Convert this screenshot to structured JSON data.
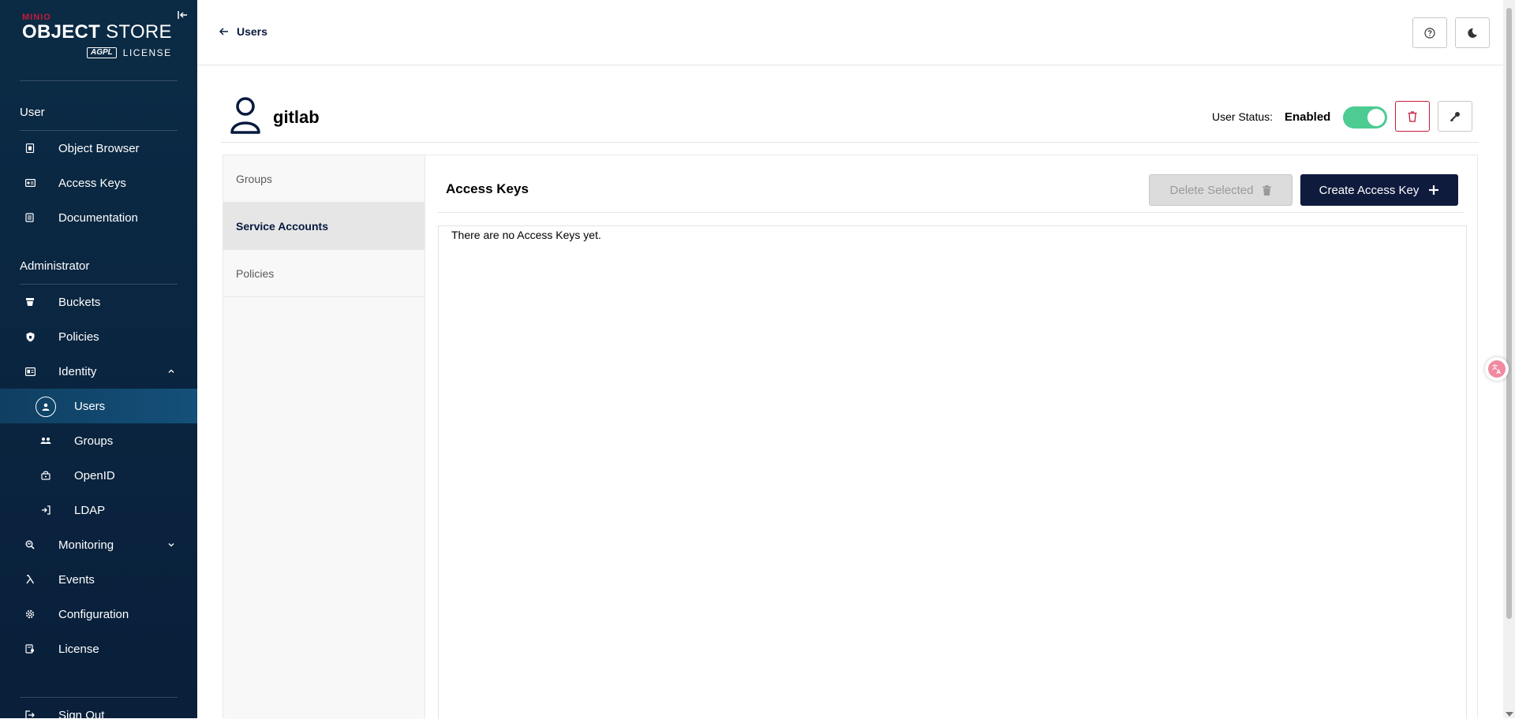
{
  "sidebar": {
    "brand": {
      "top": "MINIO",
      "product_bold": "OBJECT",
      "product_thin": "STORE",
      "agpl": "AGPL",
      "license": "LICENSE"
    },
    "sections": {
      "user": "User",
      "admin": "Administrator"
    },
    "user_items": [
      {
        "label": "Object Browser",
        "icon": "object-browser-icon"
      },
      {
        "label": "Access Keys",
        "icon": "access-keys-icon"
      },
      {
        "label": "Documentation",
        "icon": "documentation-icon"
      }
    ],
    "admin_items": {
      "buckets": "Buckets",
      "policies": "Policies",
      "identity": "Identity",
      "users": "Users",
      "groups": "Groups",
      "openid": "OpenID",
      "ldap": "LDAP",
      "monitoring": "Monitoring",
      "events": "Events",
      "configuration": "Configuration",
      "license": "License",
      "signout": "Sign Out"
    }
  },
  "topbar": {
    "back_label": "Users"
  },
  "user": {
    "name": "gitlab",
    "status_label": "User Status:",
    "status_value": "Enabled",
    "enabled": true
  },
  "tabs": [
    "Groups",
    "Service Accounts",
    "Policies"
  ],
  "active_tab": "Service Accounts",
  "content": {
    "title": "Access Keys",
    "delete_selected": "Delete Selected",
    "create_access_key": "Create Access Key",
    "empty_message": "There are no Access Keys yet."
  },
  "colors": {
    "sidebar": "#0a2540",
    "primary": "#0f1b3d",
    "danger": "#c51b3c",
    "toggle": "#4ccb92"
  }
}
